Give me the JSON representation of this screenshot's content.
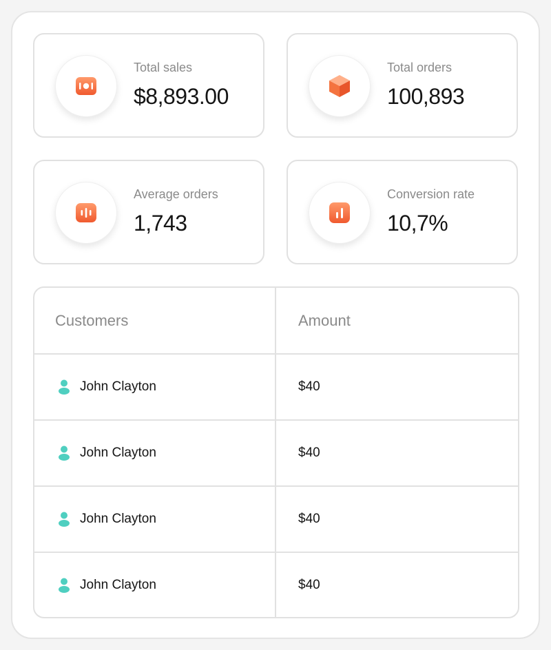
{
  "accent": "#f26a3d",
  "accent_light": "#ff8f63",
  "person_color": "#4fcfc0",
  "stats": [
    {
      "label": "Total sales",
      "value": "$8,893.00",
      "icon": "wallet-icon"
    },
    {
      "label": "Total orders",
      "value": "100,893",
      "icon": "box-icon"
    },
    {
      "label": "Average orders",
      "value": "1,743",
      "icon": "bars-icon"
    },
    {
      "label": "Conversion rate",
      "value": "10,7%",
      "icon": "chart-icon"
    }
  ],
  "table": {
    "headers": {
      "customers": "Customers",
      "amount": "Amount"
    },
    "rows": [
      {
        "customer": "John Clayton",
        "amount": "$40"
      },
      {
        "customer": "John Clayton",
        "amount": "$40"
      },
      {
        "customer": "John Clayton",
        "amount": "$40"
      },
      {
        "customer": "John Clayton",
        "amount": "$40"
      }
    ]
  }
}
